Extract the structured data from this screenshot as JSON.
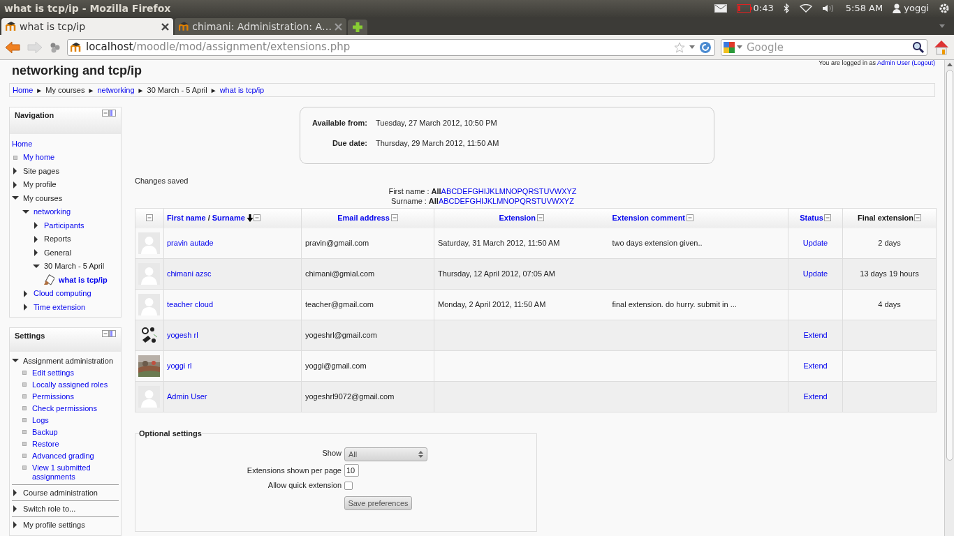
{
  "top_bar": {
    "title": "what is tcp/ip - Mozilla Firefox",
    "battery": "0:43",
    "clock": "5:58 AM",
    "user": "yoggi"
  },
  "tabs": [
    {
      "label": "what is tcp/ip",
      "selected": true
    },
    {
      "label": "chimani: Administration: A…",
      "selected": false
    }
  ],
  "address_bar": {
    "host": "localhost",
    "path": "/moodle/mod/assignment/extensions.php"
  },
  "search": {
    "placeholder": "Google"
  },
  "page": {
    "heading": "networking and tcp/ip",
    "login_prefix": "You are logged in as",
    "login_user": "Admin User",
    "logout": "(Logout)"
  },
  "breadcrumb": [
    {
      "label": "Home",
      "link": true
    },
    {
      "label": "My courses",
      "link": false
    },
    {
      "label": "networking",
      "link": true
    },
    {
      "label": "30 March - 5 April",
      "link": false
    },
    {
      "label": "what is tcp/ip",
      "link": true
    }
  ],
  "breadcrumb_separator": "►",
  "navigation": {
    "title": "Navigation",
    "items": [
      {
        "label": "Home",
        "kind": "root",
        "link": true
      },
      {
        "label": "My home",
        "kind": "leaf",
        "link": true
      },
      {
        "label": "Site pages",
        "kind": "branch",
        "expanded": false,
        "link": false
      },
      {
        "label": "My profile",
        "kind": "branch",
        "expanded": false,
        "link": false
      },
      {
        "label": "My courses",
        "kind": "branch",
        "expanded": true,
        "link": false,
        "children": [
          {
            "label": "networking",
            "kind": "branch",
            "expanded": true,
            "link": true,
            "children": [
              {
                "label": "Participants",
                "kind": "branch",
                "expanded": false,
                "link": true
              },
              {
                "label": "Reports",
                "kind": "branch",
                "expanded": false,
                "link": false
              },
              {
                "label": "General",
                "kind": "branch",
                "expanded": false,
                "link": false
              },
              {
                "label": "30 March - 5 April",
                "kind": "branch",
                "expanded": true,
                "link": false,
                "children": [
                  {
                    "label": "what is tcp/ip",
                    "kind": "activity",
                    "link": true,
                    "current": true
                  }
                ]
              }
            ]
          },
          {
            "label": "Cloud computing",
            "kind": "branch",
            "expanded": false,
            "link": true
          },
          {
            "label": "Time extension",
            "kind": "branch",
            "expanded": false,
            "link": true
          }
        ]
      }
    ]
  },
  "settings": {
    "title": "Settings",
    "sections": [
      {
        "label": "Assignment administration",
        "expanded": true,
        "children": [
          {
            "label": "Edit settings"
          },
          {
            "label": "Locally assigned roles"
          },
          {
            "label": "Permissions"
          },
          {
            "label": "Check permissions"
          },
          {
            "label": "Logs"
          },
          {
            "label": "Backup"
          },
          {
            "label": "Restore"
          },
          {
            "label": "Advanced grading"
          },
          {
            "label": "View 1 submitted assignments"
          }
        ]
      },
      {
        "label": "Course administration",
        "expanded": false
      },
      {
        "label": "Switch role to...",
        "expanded": false
      },
      {
        "label": "My profile settings",
        "expanded": false
      }
    ]
  },
  "dates": [
    {
      "label": "Available from:",
      "value": "Tuesday, 27 March 2012, 10:50 PM"
    },
    {
      "label": "Due date:",
      "value": "Thursday, 29 March 2012, 11:50 AM"
    }
  ],
  "notice": "Changes saved",
  "initials_bars": [
    {
      "label": "First name :",
      "all": "All",
      "letters": [
        "A",
        "B",
        "C",
        "D",
        "E",
        "F",
        "G",
        "H",
        "I",
        "J",
        "K",
        "L",
        "M",
        "N",
        "O",
        "P",
        "Q",
        "R",
        "S",
        "T",
        "U",
        "V",
        "W",
        "X",
        "Y",
        "Z"
      ]
    },
    {
      "label": "Surname :",
      "all": "All",
      "letters": [
        "A",
        "B",
        "C",
        "D",
        "E",
        "F",
        "G",
        "H",
        "I",
        "J",
        "K",
        "L",
        "M",
        "N",
        "O",
        "P",
        "Q",
        "R",
        "S",
        "T",
        "U",
        "V",
        "W",
        "X",
        "Y",
        "Z"
      ]
    }
  ],
  "table": {
    "columns": [
      {
        "first": "First name",
        "separator": "/",
        "second": "Surname",
        "sorted": true,
        "link": true
      },
      {
        "label": "Email address",
        "link": true
      },
      {
        "label": "Extension",
        "link": true
      },
      {
        "label": "Extension comment",
        "link": true
      },
      {
        "label": "Status",
        "link": true
      },
      {
        "label": "Final extension",
        "link": false
      }
    ],
    "rows": [
      {
        "avatar": {
          "kind": "default"
        },
        "name": "pravin autade",
        "email": "pravin@gmail.com",
        "extension": "Saturday, 31 March 2012, 11:50 AM",
        "comment": "two days extension given..",
        "status": "Update",
        "final": "2 days"
      },
      {
        "avatar": {
          "kind": "default"
        },
        "name": "chimani azsc",
        "email": "chimani@gmial.com",
        "extension": "Thursday, 12 April 2012, 07:05 AM",
        "status": "Update",
        "final": "13 days 19 hours"
      },
      {
        "avatar": {
          "kind": "default"
        },
        "name": "teacher cloud",
        "email": "teacher@gmail.com",
        "extension": "Monday, 2 April 2012, 11:50 AM",
        "comment": "final extension. do hurry. submit in ...",
        "final": "4 days"
      },
      {
        "avatar": {
          "kind": "panda"
        },
        "name": "yogesh rl",
        "email": "yogeshrl@gmail.com",
        "status": "Extend"
      },
      {
        "name": "yoggi rl",
        "email": "yoggi@gmail.com",
        "status": "Extend"
      },
      {
        "avatar": {
          "kind": "default"
        },
        "name": "Admin User",
        "email": "yogeshrl9072@gmail.com",
        "status": "Extend"
      }
    ]
  },
  "optional_settings": {
    "legend": "Optional settings",
    "show_label": "Show",
    "show_value": "All",
    "per_page_label": "Extensions shown per page",
    "per_page_value": "10",
    "quick_label": "Allow quick extension",
    "quick_checked": false,
    "save": "Save preferences"
  }
}
